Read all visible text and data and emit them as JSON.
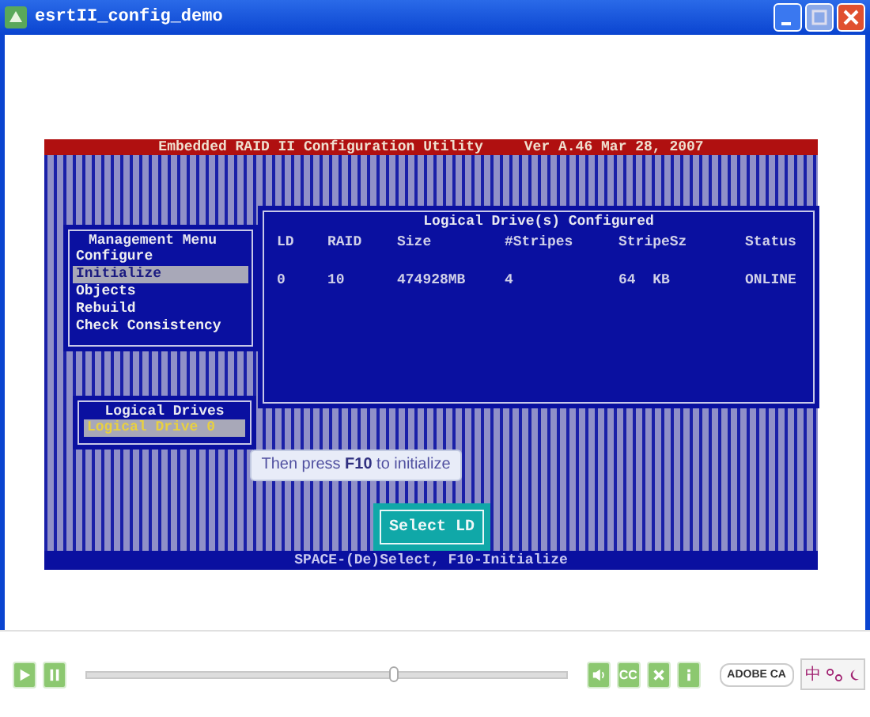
{
  "window": {
    "title": "esrtII_config_demo"
  },
  "console": {
    "header": {
      "title": "Embedded RAID II Configuration Utility",
      "version": "Ver A.46 Mar 28, 2007"
    },
    "management_menu": {
      "title": "Management Menu",
      "items": [
        {
          "label": "Configure",
          "selected": false
        },
        {
          "label": "Initialize",
          "selected": true
        },
        {
          "label": "Objects",
          "selected": false
        },
        {
          "label": "Rebuild",
          "selected": false
        },
        {
          "label": "Check Consistency",
          "selected": false
        }
      ]
    },
    "drives_panel": {
      "title": "Logical Drive(s) Configured",
      "columns": [
        "LD",
        "RAID",
        "Size",
        "#Stripes",
        "StripeSz",
        "Status"
      ],
      "rows": [
        [
          "0",
          "10",
          "474928MB",
          "4",
          "64  KB",
          "ONLINE"
        ]
      ]
    },
    "logical_drives": {
      "title": "Logical Drives",
      "items": [
        {
          "label": "Logical Drive 0",
          "selected": true
        }
      ]
    },
    "tooltip": "Then press **F10** to initialize",
    "button": "Select LD",
    "status_bar": "SPACE-(De)Select,  F10-Initialize"
  },
  "player": {
    "progress": {
      "level": 0.64
    },
    "captions_label": "CC",
    "brand_label": "ADOBE CA",
    "ime_label": "中"
  }
}
